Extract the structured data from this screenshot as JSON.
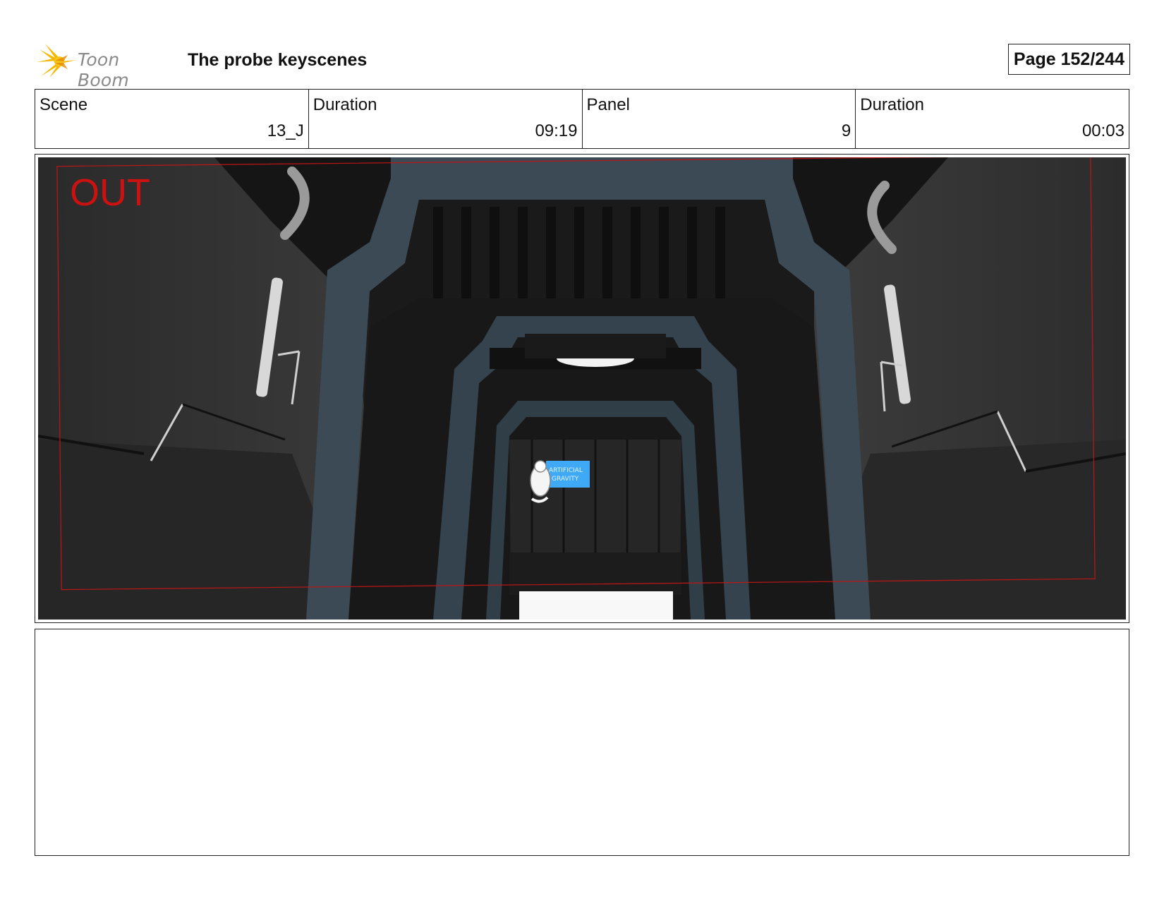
{
  "header": {
    "logo_text": "Toon Boom",
    "title": "The probe keyscenes",
    "page": "Page 152/244"
  },
  "info": {
    "scene_label": "Scene",
    "scene_value": "13_J",
    "duration_label": "Duration",
    "duration_value": "09:19",
    "panel_label": "Panel",
    "panel_value": "9",
    "panel_duration_label": "Duration",
    "panel_duration_value": "00:03"
  },
  "panel": {
    "annotation": "OUT",
    "sign_line1": "ARTIFICIAL",
    "sign_line2": "GRAVITY"
  },
  "colors": {
    "annotation_red": "#cc1111",
    "logo_yellow": "#f5b800",
    "sign_blue": "#3fa9f5"
  }
}
